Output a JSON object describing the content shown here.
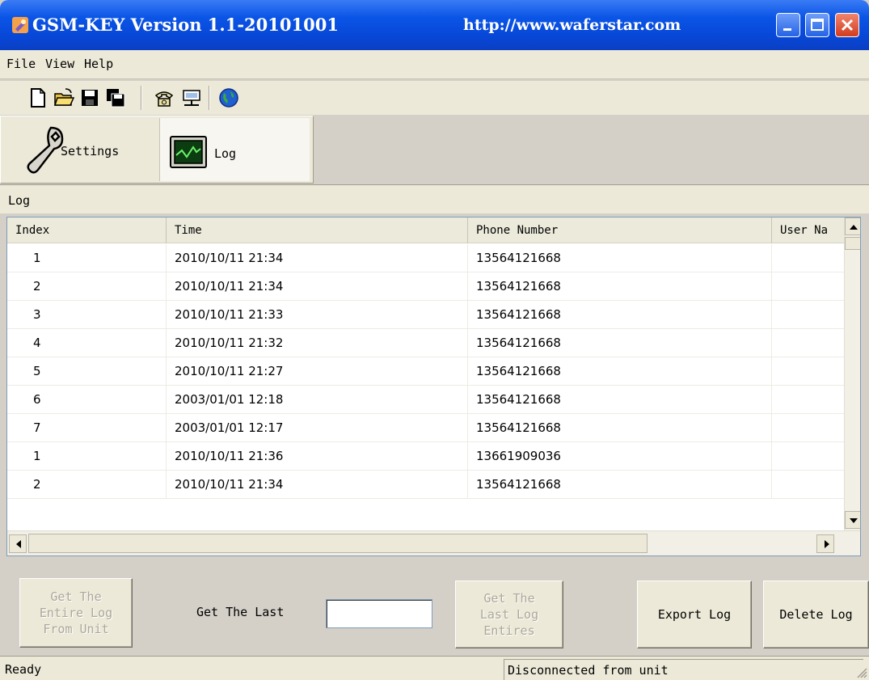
{
  "window": {
    "title": "GSM-KEY Version 1.1-20101001",
    "url": "http://www.waferstar.com"
  },
  "menu": {
    "items": [
      "File",
      "View",
      "Help"
    ]
  },
  "toolbar": {
    "icons": [
      "new-file-icon",
      "open-folder-icon",
      "save-icon",
      "save-all-icon",
      "phone-icon",
      "network-icon",
      "globe-icon"
    ]
  },
  "tabs": [
    {
      "label": "Settings",
      "icon": "wrench-icon"
    },
    {
      "label": "Log",
      "icon": "monitor-chart-icon"
    }
  ],
  "log": {
    "header": "Log",
    "columns": [
      "Index",
      "Time",
      "Phone Number",
      "User Na"
    ],
    "rows": [
      {
        "index": "1",
        "time": "2010/10/11 21:34",
        "phone": "13564121668",
        "user": ""
      },
      {
        "index": "2",
        "time": "2010/10/11 21:34",
        "phone": "13564121668",
        "user": ""
      },
      {
        "index": "3",
        "time": "2010/10/11 21:33",
        "phone": "13564121668",
        "user": ""
      },
      {
        "index": "4",
        "time": "2010/10/11 21:32",
        "phone": "13564121668",
        "user": ""
      },
      {
        "index": "5",
        "time": "2010/10/11 21:27",
        "phone": "13564121668",
        "user": ""
      },
      {
        "index": "6",
        "time": "2003/01/01 12:18",
        "phone": "13564121668",
        "user": ""
      },
      {
        "index": "7",
        "time": "2003/01/01 12:17",
        "phone": "13564121668",
        "user": ""
      },
      {
        "index": "1",
        "time": "2010/10/11 21:36",
        "phone": "13661909036",
        "user": ""
      },
      {
        "index": "2",
        "time": "2010/10/11 21:34",
        "phone": "13564121668",
        "user": ""
      }
    ]
  },
  "controls": {
    "get_entire_log": "Get The\nEntire Log\nFrom Unit",
    "get_the_last_label": "Get The Last",
    "get_the_last_value": "",
    "get_last_entries": "Get The\nLast Log\nEntires",
    "export_log": "Export Log",
    "delete_log": "Delete Log"
  },
  "status": {
    "left": "Ready",
    "right": "Disconnected from unit"
  },
  "colors": {
    "titlebar": "#0a55e6",
    "close_button": "#d23c1e",
    "window_bg": "#d4d0c8",
    "disabled_text": "#aca899"
  }
}
